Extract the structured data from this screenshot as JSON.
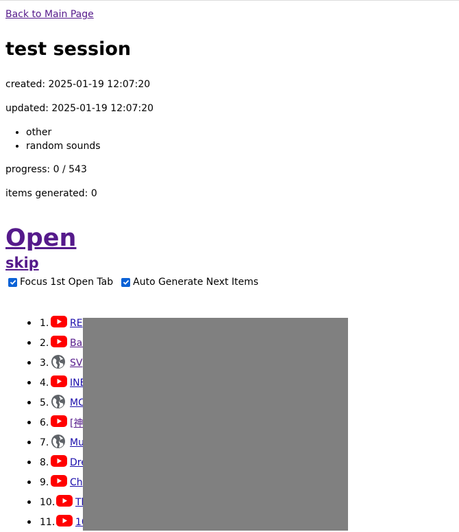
{
  "nav": {
    "back_label": "Back to Main Page"
  },
  "session": {
    "title": "test session",
    "created": "created: 2025-01-19 12:07:20",
    "updated": "updated: 2025-01-19 12:07:20",
    "tags": [
      "other",
      "random sounds"
    ],
    "progress": "progress: 0 / 543",
    "items_generated": "items generated: 0"
  },
  "actions": {
    "open_label": "Open",
    "skip_label": "skip"
  },
  "options": [
    {
      "label": "Focus 1st Open Tab",
      "checked": true
    },
    {
      "label": "Auto Generate Next Items",
      "checked": true
    }
  ],
  "items": [
    {
      "num": "1.",
      "icon": "youtube-icon",
      "text": "RE"
    },
    {
      "num": "2.",
      "icon": "youtube-icon",
      "text": "Bas"
    },
    {
      "num": "3.",
      "icon": "globe-icon",
      "text": "SV"
    },
    {
      "num": "4.",
      "icon": "youtube-icon",
      "text": "INE"
    },
    {
      "num": "5.",
      "icon": "globe-icon",
      "text": "MC"
    },
    {
      "num": "6.",
      "icon": "youtube-icon",
      "text": "[神"
    },
    {
      "num": "7.",
      "icon": "globe-icon",
      "text": "Mu"
    },
    {
      "num": "8.",
      "icon": "youtube-icon",
      "text": "Dre"
    },
    {
      "num": "9.",
      "icon": "youtube-icon",
      "text": "Ch"
    },
    {
      "num": "10.",
      "icon": "youtube-icon",
      "text": "Th"
    },
    {
      "num": "11.",
      "icon": "youtube-icon",
      "text": "10"
    }
  ],
  "colors": {
    "visited_link": "#551a8b",
    "link": "#1a0dab",
    "youtube_red": "#ff0000",
    "checkbox": "#0b62d6",
    "redaction": "#808080"
  }
}
